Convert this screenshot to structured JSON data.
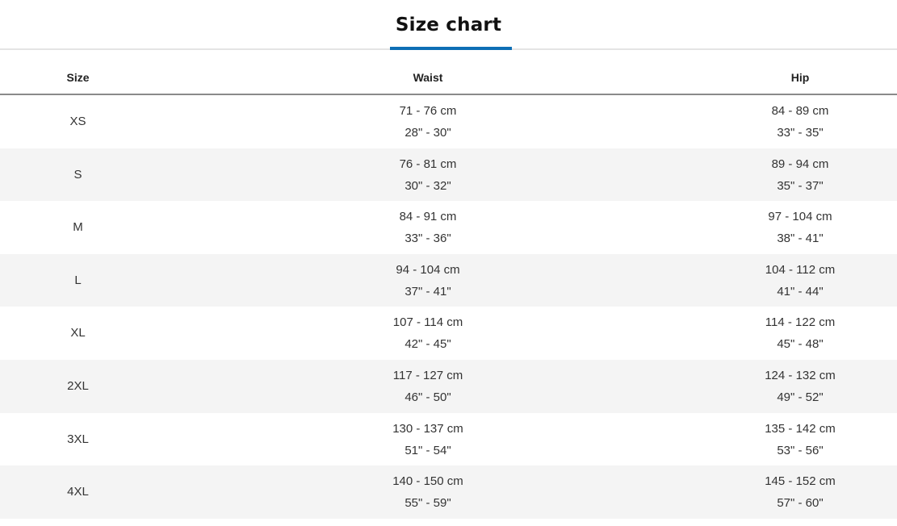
{
  "title": "Size chart",
  "accent_color": "#0d6eb5",
  "columns": [
    "Size",
    "Waist",
    "Hip"
  ],
  "rows": [
    {
      "size": "XS",
      "waist_cm": "71 - 76 cm",
      "waist_in": "28\" - 30\"",
      "hip_cm": "84 - 89 cm",
      "hip_in": "33\" - 35\""
    },
    {
      "size": "S",
      "waist_cm": "76 - 81 cm",
      "waist_in": "30\" - 32\"",
      "hip_cm": "89 - 94 cm",
      "hip_in": "35\" - 37\""
    },
    {
      "size": "M",
      "waist_cm": "84 - 91 cm",
      "waist_in": "33\" - 36\"",
      "hip_cm": "97 - 104 cm",
      "hip_in": "38\" - 41\""
    },
    {
      "size": "L",
      "waist_cm": "94 - 104 cm",
      "waist_in": "37\" - 41\"",
      "hip_cm": "104 - 112 cm",
      "hip_in": "41\" - 44\""
    },
    {
      "size": "XL",
      "waist_cm": "107 - 114 cm",
      "waist_in": "42\" - 45\"",
      "hip_cm": "114 - 122 cm",
      "hip_in": "45\" - 48\""
    },
    {
      "size": "2XL",
      "waist_cm": "117 - 127 cm",
      "waist_in": "46\" - 50\"",
      "hip_cm": "124 - 132 cm",
      "hip_in": "49\" - 52\""
    },
    {
      "size": "3XL",
      "waist_cm": "130 - 137 cm",
      "waist_in": "51\" - 54\"",
      "hip_cm": "135 - 142 cm",
      "hip_in": "53\" - 56\""
    },
    {
      "size": "4XL",
      "waist_cm": "140 - 150 cm",
      "waist_in": "55\" - 59\"",
      "hip_cm": "145 - 152 cm",
      "hip_in": "57\" - 60\""
    }
  ]
}
